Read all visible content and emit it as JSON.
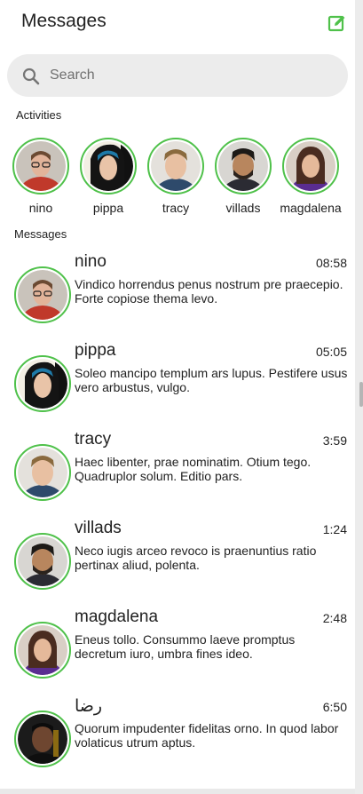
{
  "header": {
    "title": "Messages"
  },
  "search": {
    "placeholder": "Search"
  },
  "sections": {
    "activities": "Activities",
    "messages": "Messages"
  },
  "activities": [
    {
      "name": "nino"
    },
    {
      "name": "pippa"
    },
    {
      "name": "tracy"
    },
    {
      "name": "villads"
    },
    {
      "name": "magdalena"
    }
  ],
  "messages": [
    {
      "name": "nino",
      "time": "08:58",
      "text": "Vindico horrendus penus nostrum pre praecepio. Forte copiose thema levo."
    },
    {
      "name": "pippa",
      "time": "05:05",
      "text": "Soleo mancipo templum ars lupus. Pestifere usus vero arbustus, vulgo."
    },
    {
      "name": "tracy",
      "time": "3:59",
      "text": "Haec libenter, prae nominatim. Otium tego. Quadruplor solum. Editio pars."
    },
    {
      "name": "villads",
      "time": "1:24",
      "text": "Neco iugis arceo revoco is praenuntius ratio pertinax aliud, polenta."
    },
    {
      "name": "magdalena",
      "time": "2:48",
      "text": "Eneus tollo. Consummo laeve promptus decretum iuro, umbra fines ideo."
    },
    {
      "name": "رضا",
      "time": "6:50",
      "text": "Quorum impudenter fidelitas orno. In quod labor volaticus utrum aptus."
    }
  ],
  "colors": {
    "accent": "#4fc14a",
    "search_bg": "#ececec"
  },
  "icons": {
    "compose": "edit-square-icon",
    "search": "search-icon"
  }
}
